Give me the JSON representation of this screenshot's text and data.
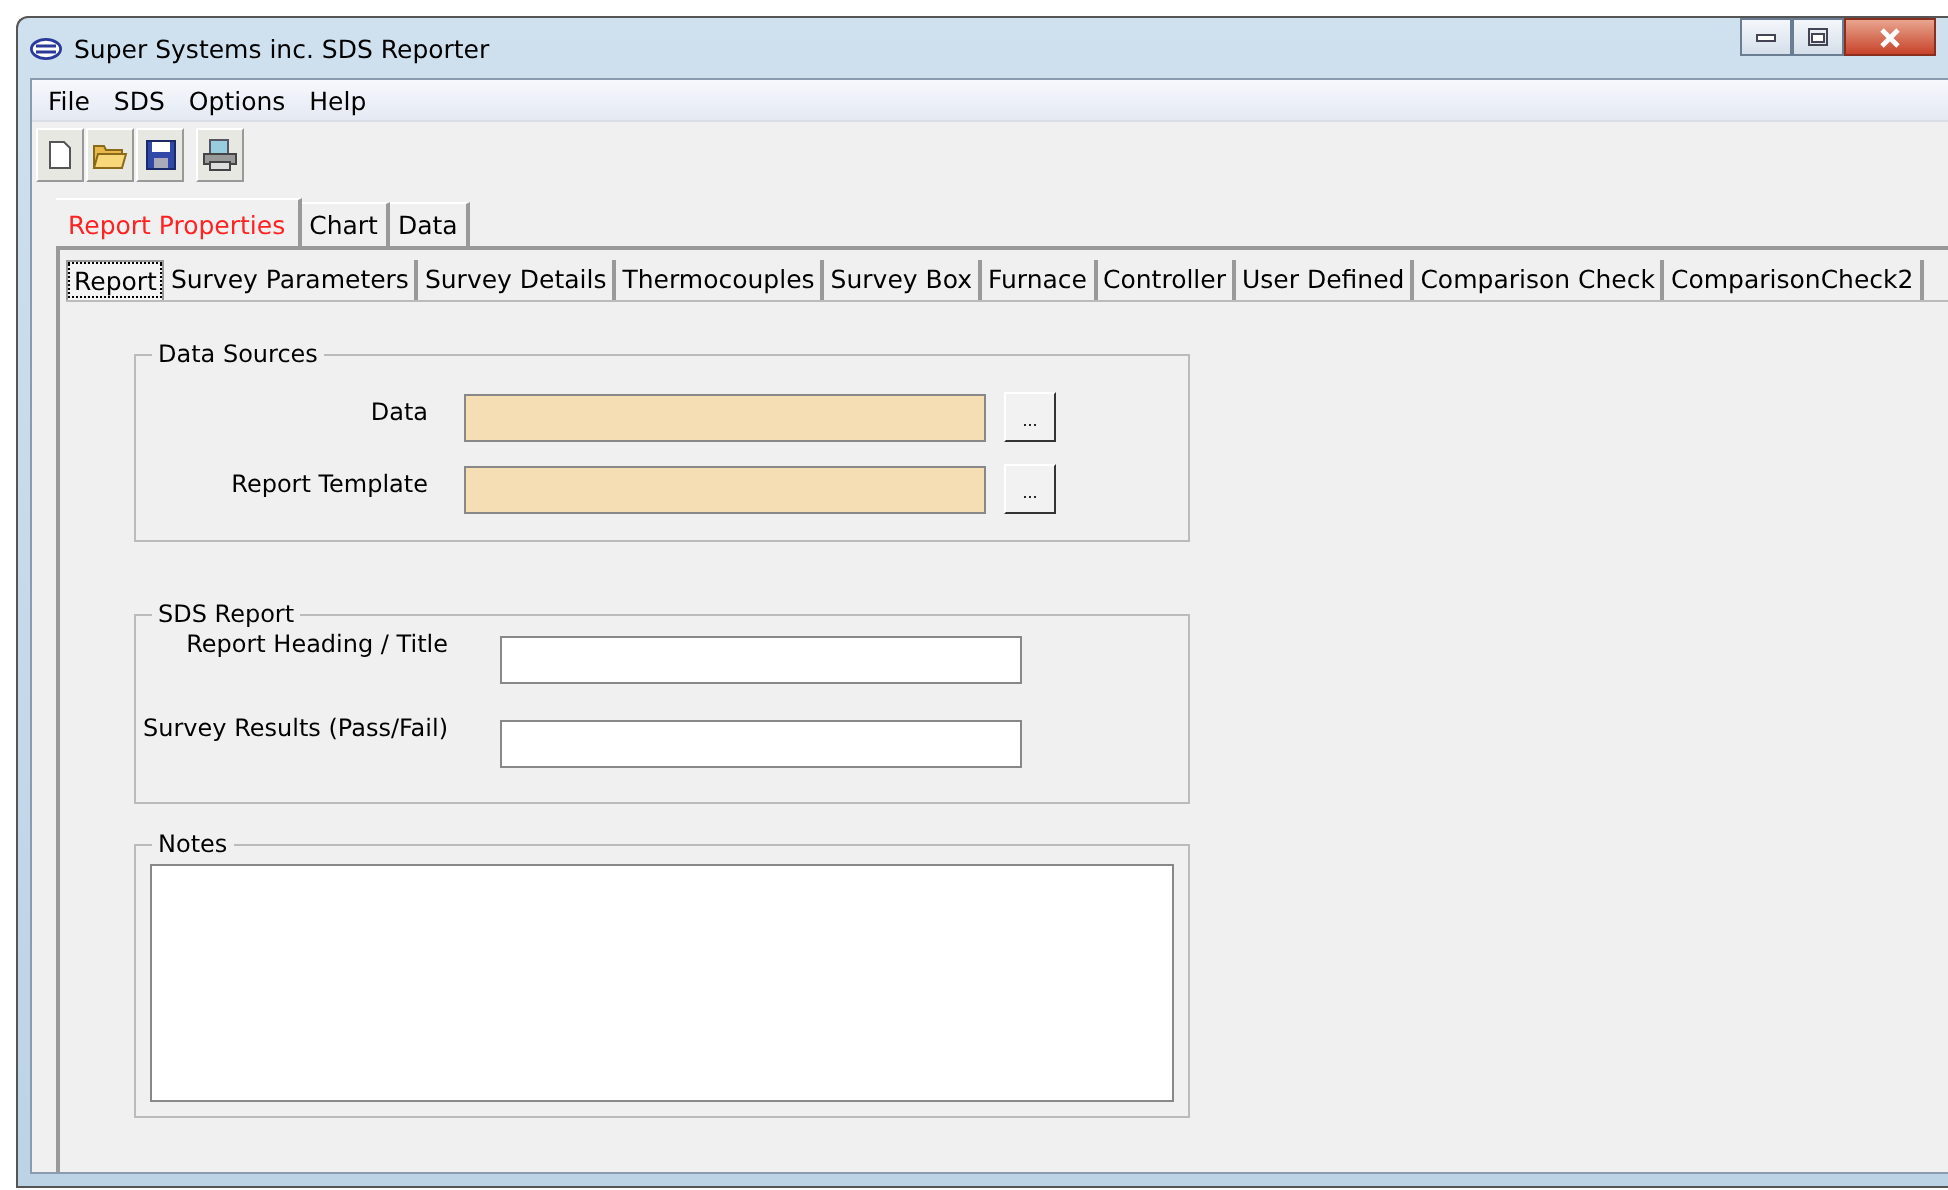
{
  "window": {
    "title": "Super Systems inc. SDS Reporter"
  },
  "menu": [
    "File",
    "SDS",
    "Options",
    "Help"
  ],
  "toolbar": [
    {
      "kind": "new"
    },
    {
      "kind": "open"
    },
    {
      "kind": "save"
    },
    {
      "kind": "print"
    }
  ],
  "tabs": [
    {
      "label": "Report Properties",
      "selected": true
    },
    {
      "label": "Chart",
      "selected": false
    },
    {
      "label": "Data",
      "selected": false
    }
  ],
  "subtabs": [
    {
      "label": "Report",
      "selected": true
    },
    {
      "label": "Survey Parameters",
      "selected": false
    },
    {
      "label": "Survey Details",
      "selected": false
    },
    {
      "label": "Thermocouples",
      "selected": false
    },
    {
      "label": "Survey Box",
      "selected": false
    },
    {
      "label": "Furnace",
      "selected": false
    },
    {
      "label": "Controller",
      "selected": false
    },
    {
      "label": "User Defined",
      "selected": false
    },
    {
      "label": "Comparison Check",
      "selected": false
    },
    {
      "label": "ComparisonCheck2",
      "selected": false
    }
  ],
  "data_sources": {
    "title": "Data Sources",
    "fields": [
      {
        "label": "Data",
        "kind": "file",
        "browse": "..."
      },
      {
        "label": "Report Template",
        "kind": "file",
        "browse": "..."
      }
    ]
  },
  "sds_report": {
    "title": "SDS Report",
    "fields": [
      {
        "label": "Report Heading / Title",
        "kind": "text"
      },
      {
        "label": "Survey Results (Pass/Fail)",
        "kind": "text"
      }
    ]
  },
  "notes": {
    "title": "Notes"
  }
}
